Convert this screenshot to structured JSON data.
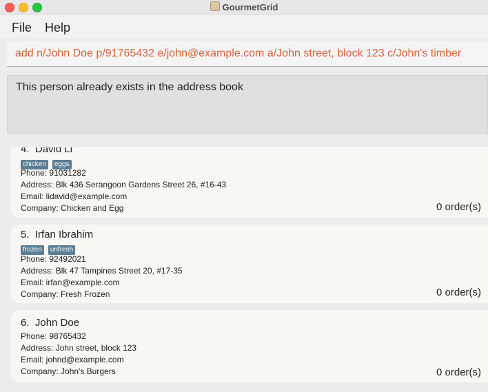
{
  "window": {
    "title": "GourmetGrid"
  },
  "menu": {
    "file": "File",
    "help": "Help"
  },
  "command": {
    "value": "add n/John Doe p/91765432 e/john@example.com a/John street, block 123 c/John's timber"
  },
  "result": {
    "message": "This person already exists in the address book"
  },
  "persons": [
    {
      "index": "4.",
      "name": "David Li",
      "tags": [
        "chicken",
        "eggs"
      ],
      "phone": "Phone: 91031282",
      "address": "Address: Blk 436 Serangoon Gardens Street 26, #16-43",
      "email": "Email: lidavid@example.com",
      "company": "Company: Chicken and Egg",
      "orders": "0 order(s)"
    },
    {
      "index": "5.",
      "name": "Irfan Ibrahim",
      "tags": [
        "frozen",
        "unfresh"
      ],
      "phone": "Phone: 92492021",
      "address": "Address: Blk 47 Tampines Street 20, #17-35",
      "email": "Email: irfan@example.com",
      "company": "Company: Fresh Frozen",
      "orders": "0 order(s)"
    },
    {
      "index": "6.",
      "name": "John Doe",
      "tags": [],
      "phone": "Phone: 98765432",
      "address": "Address: John street, block 123",
      "email": "Email: johnd@example.com",
      "company": "Company: John's Burgers",
      "orders": "0 order(s)"
    }
  ],
  "colors": {
    "command_text": "#d0643f",
    "tag_bg": "#5a7d93",
    "card_bg": "#f8f7f4"
  }
}
